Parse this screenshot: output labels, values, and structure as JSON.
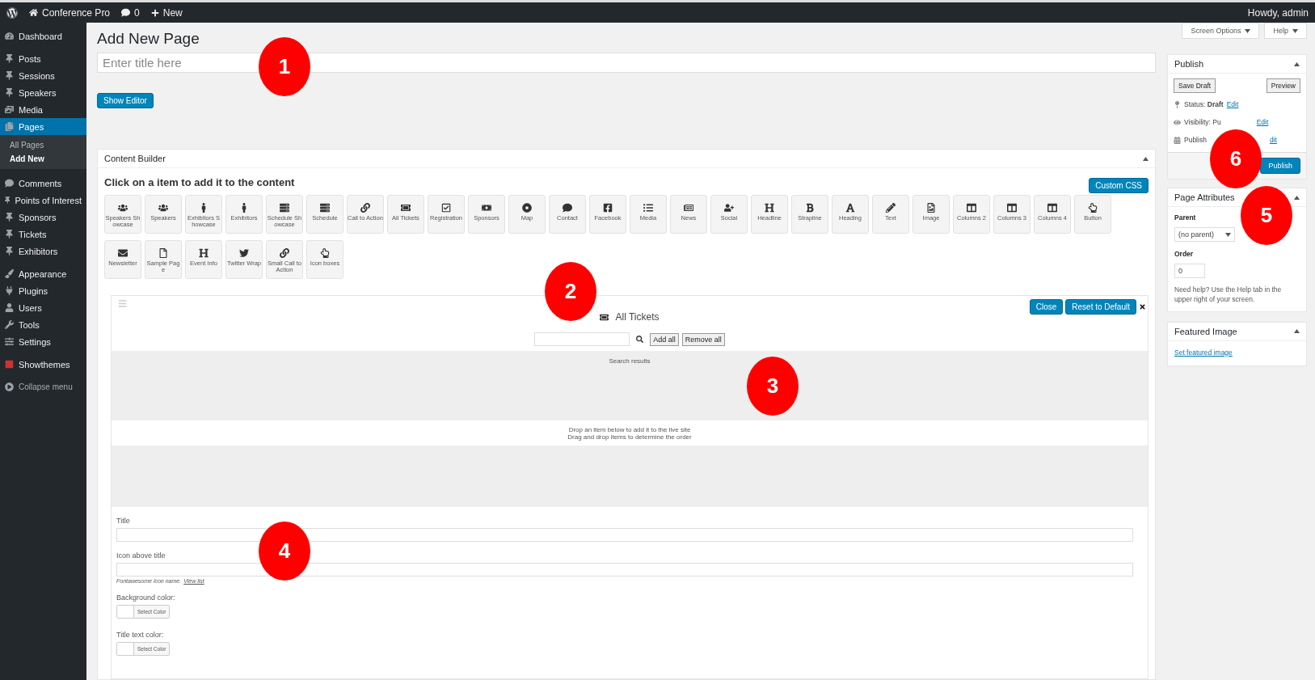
{
  "admin_bar": {
    "site": "Conference Pro",
    "comments": "0",
    "new": "New",
    "greeting": "Howdy, admin"
  },
  "sidebar": {
    "items": [
      {
        "label": "Dashboard",
        "selected": false
      },
      {
        "label": "Posts",
        "selected": false
      },
      {
        "label": "Sessions",
        "selected": false
      },
      {
        "label": "Speakers",
        "selected": false
      },
      {
        "label": "Media",
        "selected": false
      },
      {
        "label": "Pages",
        "selected": true,
        "children": [
          {
            "label": "All Pages",
            "selected": false
          },
          {
            "label": "Add New",
            "selected": true
          }
        ]
      },
      {
        "label": "Comments",
        "selected": false
      },
      {
        "label": "Points of Interest",
        "selected": false
      },
      {
        "label": "Sponsors",
        "selected": false
      },
      {
        "label": "Tickets",
        "selected": false
      },
      {
        "label": "Exhibitors",
        "selected": false
      },
      {
        "label": "Appearance",
        "selected": false
      },
      {
        "label": "Plugins",
        "selected": false
      },
      {
        "label": "Users",
        "selected": false
      },
      {
        "label": "Tools",
        "selected": false
      },
      {
        "label": "Settings",
        "selected": false
      },
      {
        "label": "Showthemes",
        "selected": false
      }
    ],
    "collapse": "Collapse menu"
  },
  "screen_options": [
    "Screen Options",
    "Help"
  ],
  "page_title": "Add New Page",
  "title_field": {
    "placeholder": "Enter title here"
  },
  "show_editor": "Show Editor",
  "content_builder": {
    "title": "Content Builder",
    "instruction": "Click on a item to add it to the content",
    "custom_css": "Custom CSS",
    "items": [
      {
        "label": "Speakers Showcase"
      },
      {
        "label": "Speakers"
      },
      {
        "label": "Exhibitors Showcase"
      },
      {
        "label": "Exhibitors"
      },
      {
        "label": "Schedule Showcase"
      },
      {
        "label": "Schedule"
      },
      {
        "label": "Call to Action"
      },
      {
        "label": "All Tickets"
      },
      {
        "label": "Registration"
      },
      {
        "label": "Sponsors"
      },
      {
        "label": "Map"
      },
      {
        "label": "Contact"
      },
      {
        "label": "Facebook"
      },
      {
        "label": "Media"
      },
      {
        "label": "News"
      },
      {
        "label": "Social"
      },
      {
        "label": "Headline"
      },
      {
        "label": "Strapline"
      },
      {
        "label": "Heading"
      },
      {
        "label": "Text"
      },
      {
        "label": "Image"
      },
      {
        "label": "Columns 2"
      },
      {
        "label": "Columns 3"
      },
      {
        "label": "Columns 4"
      },
      {
        "label": "Button"
      },
      {
        "label": "Newsletter"
      },
      {
        "label": "Sample Page"
      },
      {
        "label": "Event Info"
      },
      {
        "label": "Twitter Wrap"
      },
      {
        "label": "Small Call to Action"
      },
      {
        "label": "Icon boxes"
      }
    ]
  },
  "widget": {
    "title": "All Tickets",
    "close": "Close",
    "reset": "Reset to Default",
    "add_all": "Add all",
    "remove_all": "Remove all",
    "search_results": "Search results",
    "drop_hint": [
      "Drop an item below to add it to the live site",
      "Drag and drop items to determine the order"
    ],
    "fields": [
      {
        "kind": "text",
        "label": "Title"
      },
      {
        "kind": "text",
        "label": "Icon above title",
        "hint": "Fontawesome icon name.",
        "link": "View list"
      },
      {
        "kind": "color",
        "label": "Background color:",
        "button": "Select Color"
      },
      {
        "kind": "color",
        "label": "Title text color:",
        "button": "Select Color"
      }
    ]
  },
  "publish": {
    "title": "Publish",
    "save_draft": "Save Draft",
    "preview": "Preview",
    "status_label": "Status:",
    "status": "Draft",
    "visibility_label": "Visibility: Pu",
    "publish_label": "Publish",
    "status_edit": "Edit",
    "visibility_edit": "Edit",
    "publish_edit": "dit",
    "publish_button": "Publish"
  },
  "page_attributes": {
    "title": "Page Attributes",
    "parent_label": "Parent",
    "parent": "(no parent)",
    "order_label": "Order",
    "order": "0",
    "help": "Need help? Use the Help tab in the upper right of your screen."
  },
  "featured_image": {
    "title": "Featured Image",
    "link": "Set featured image"
  },
  "callouts": [
    {
      "label": "1"
    },
    {
      "label": "2"
    },
    {
      "label": "3"
    },
    {
      "label": "4"
    },
    {
      "label": "5"
    },
    {
      "label": "6"
    }
  ]
}
